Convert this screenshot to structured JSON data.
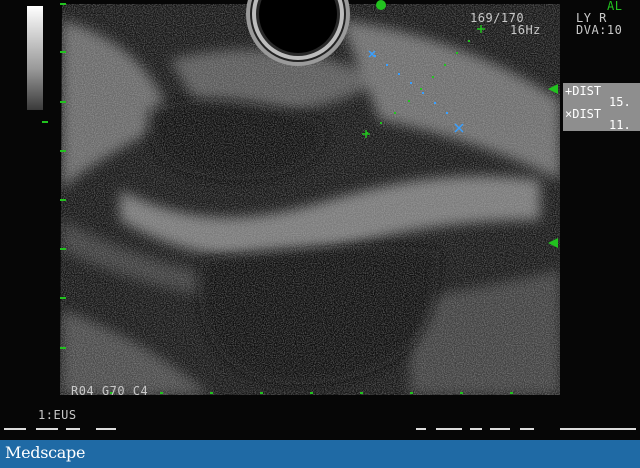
{
  "overlay": {
    "top_right_partial": "AL",
    "frame_counter": "169/170",
    "frequency": "16Hz",
    "orientation": "LY R",
    "dva": "DVA:10",
    "gain_settings": "R04 G70 C4",
    "mode_label": "1:EUS"
  },
  "measurements": [
    {
      "label": "+DIST",
      "value": "15."
    },
    {
      "label": "×DIST",
      "value": "11."
    }
  ],
  "footer": {
    "brand": "Medscape"
  },
  "colors": {
    "overlay_text": "#c8c8c8",
    "marker_green": "#22c21f",
    "caliper_plus": "#22c21f",
    "caliper_x": "#3aa0ff",
    "measure_box": "#8e8e8e",
    "footer_bg": "#1f6aa5"
  },
  "icons": {
    "side_markers": "triangle-left-marker-icon",
    "top_marker": "circle-marker-icon",
    "transducer": "transducer-ring-icon",
    "calipers": [
      "plus-caliper-icon",
      "x-caliper-icon"
    ]
  }
}
